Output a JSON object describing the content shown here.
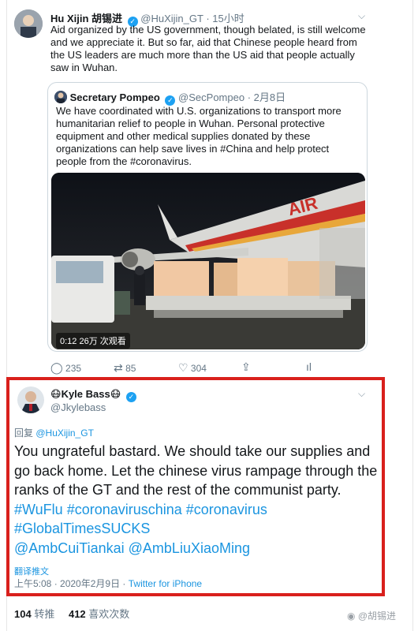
{
  "tweet1": {
    "name": "Hu Xijin 胡锡进",
    "handle": "@HuXijin_GT",
    "time": "· 15小时",
    "body": "Aid organized by the US government, though belated, is still welcome and we appreciate it. But so far, aid that Chinese people heard from the US leaders are much more than the US aid that people actually saw in Wuhan."
  },
  "quoted": {
    "name": "Secretary Pompeo",
    "handle": "@SecPompeo",
    "time": "· 2月8日",
    "body": "We have coordinated with U.S. organizations to transport more humanitarian relief to people in Wuhan. Personal protective equipment and other medical supplies donated by these organizations can help save lives in #China and help protect people from the #coronavirus.",
    "video_time": "0:12",
    "video_views": "26万 次观看",
    "plane_text": "AIR"
  },
  "tweet1_actions": {
    "replies": "235",
    "retweets": "85",
    "likes": "304"
  },
  "reply": {
    "name": "Kyle Bass",
    "handle": "@Jkylebass",
    "replying_to_label": "回复",
    "replying_to": "@HuXijin_GT",
    "body_text": "You ungrateful bastard. We should take our supplies and go back home. Let the chinese virus rampage through the ranks of the GT and the rest of the communist party.",
    "hashtags": "#WuFlu #coronaviruschina #coronavirus #GlobalTimesSUCKS",
    "mentions": "@AmbCuiTiankai @AmbLiuXiaoMing",
    "translate": "翻译推文",
    "timestamp": "上午5:08 · 2020年2月9日 · ",
    "source": "Twitter for iPhone"
  },
  "stats": {
    "retweets_count": "104",
    "retweets_label": "转推",
    "likes_count": "412",
    "likes_label": "喜欢次数"
  },
  "watermark": "@胡锡进",
  "colors": {
    "verified": "#1da1f2",
    "link": "#1b95e0",
    "highlight_border": "#d9201c"
  },
  "icons": [
    "chevron-down-icon",
    "verified-icon",
    "reply-icon",
    "retweet-icon",
    "like-icon",
    "share-icon",
    "analytics-icon",
    "weibo-icon"
  ]
}
